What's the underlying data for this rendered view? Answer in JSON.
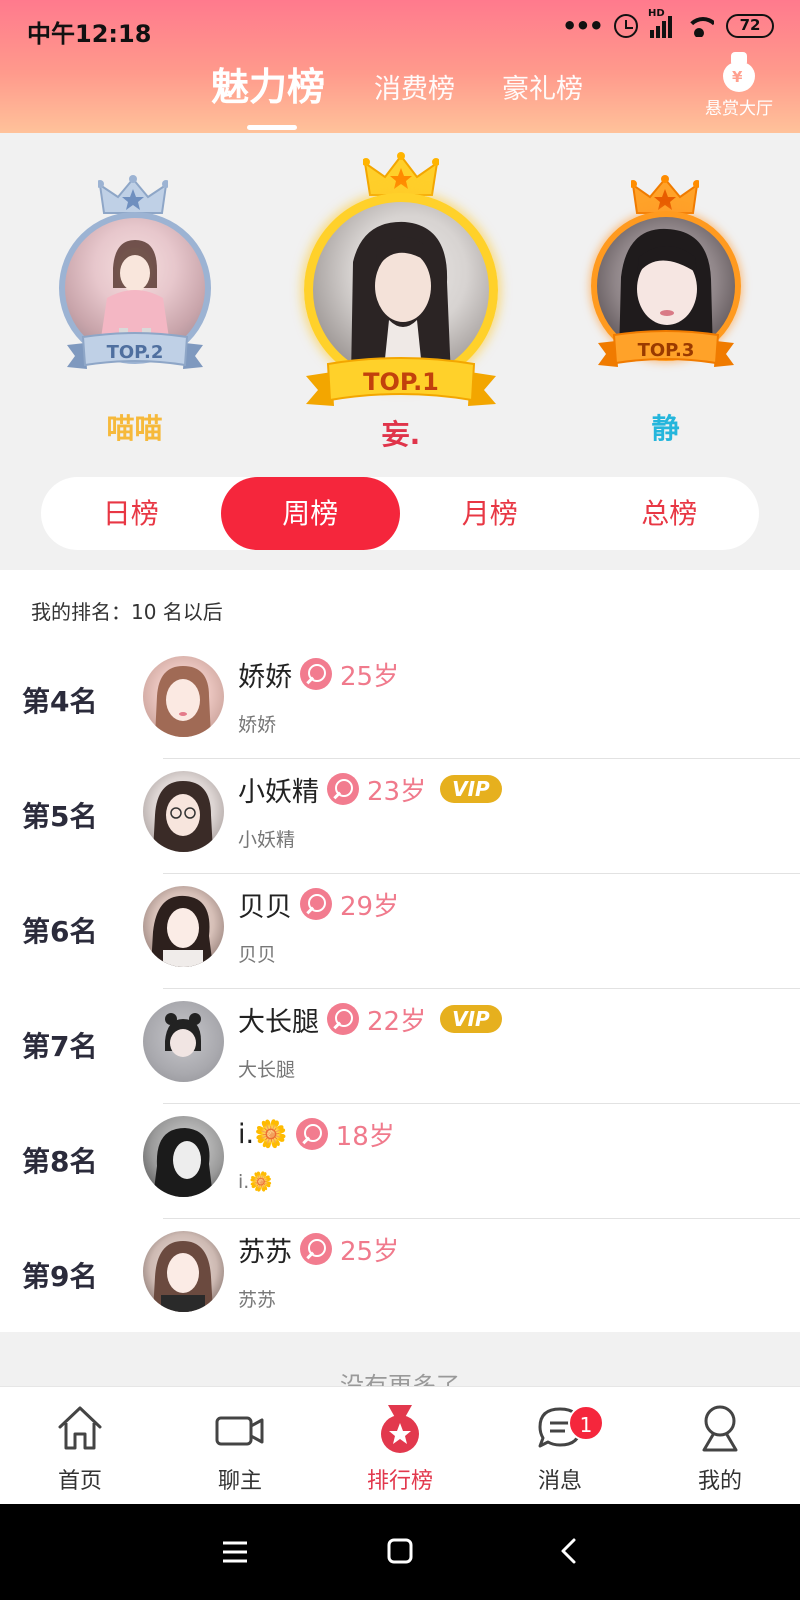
{
  "status_bar": {
    "time": "中午12:18",
    "battery": "72",
    "hd": "HD"
  },
  "header": {
    "tabs": [
      "魅力榜",
      "消费榜",
      "豪礼榜"
    ],
    "active_tab": "魅力榜",
    "reward_hall": "悬赏大厅",
    "reward_symbol": "¥"
  },
  "podium": {
    "top1": {
      "badge": "TOP.1",
      "name": "妄.",
      "color": "#e0344a",
      "ring": "#ffd12a"
    },
    "top2": {
      "badge": "TOP.2",
      "name": "喵喵",
      "color": "#f6b93b",
      "ring": "#9cb3d3"
    },
    "top3": {
      "badge": "TOP.3",
      "name": "静",
      "color": "#25b6dc",
      "ring": "#ff9a1f"
    }
  },
  "period_tabs": [
    "日榜",
    "周榜",
    "月榜",
    "总榜"
  ],
  "active_period": "周榜",
  "my_rank": "我的排名：10 名以后",
  "list": [
    {
      "rank": "第4名",
      "name": "娇娇",
      "age": "25岁",
      "vip": "",
      "sub": "娇娇"
    },
    {
      "rank": "第5名",
      "name": "小妖精",
      "age": "23岁",
      "vip": "VIP",
      "sub": "小妖精"
    },
    {
      "rank": "第6名",
      "name": "贝贝",
      "age": "29岁",
      "vip": "",
      "sub": "贝贝"
    },
    {
      "rank": "第7名",
      "name": "大长腿",
      "age": "22岁",
      "vip": "VIP",
      "sub": "大长腿"
    },
    {
      "rank": "第8名",
      "name": "i.🌼",
      "age": "18岁",
      "vip": "",
      "sub": "i.🌼"
    },
    {
      "rank": "第9名",
      "name": "苏苏",
      "age": "25岁",
      "vip": "",
      "sub": "苏苏"
    }
  ],
  "no_more": "没有更多了",
  "bottom_nav": [
    {
      "label": "首页",
      "icon": "home-icon"
    },
    {
      "label": "聊主",
      "icon": "video-camera-icon"
    },
    {
      "label": "排行榜",
      "icon": "medal-icon"
    },
    {
      "label": "消息",
      "icon": "message-icon",
      "badge": "1"
    },
    {
      "label": "我的",
      "icon": "profile-icon"
    }
  ],
  "active_nav": "排行榜"
}
